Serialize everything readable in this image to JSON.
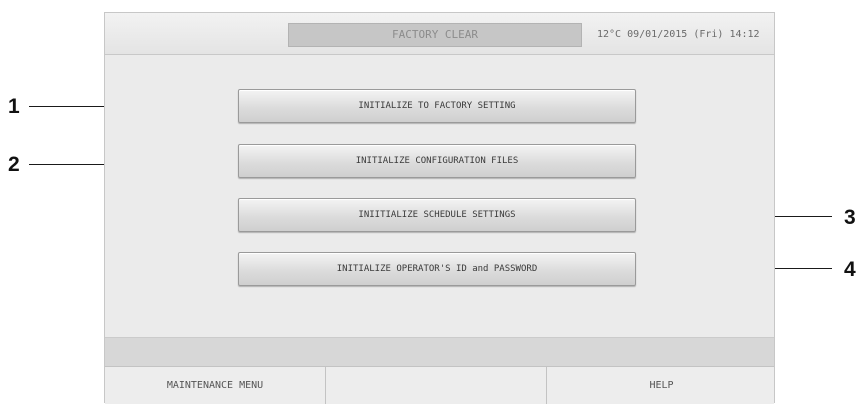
{
  "header": {
    "title": "FACTORY CLEAR",
    "status": "12°C  09/01/2015 (Fri) 14:12"
  },
  "buttons": [
    {
      "label": "INITIALIZE TO FACTORY SETTING"
    },
    {
      "label": "INITIALIZE CONFIGURATION FILES"
    },
    {
      "label": "INIITIALIZE SCHEDULE SETTINGS"
    },
    {
      "label": "INITIALIZE OPERATOR'S ID and PASSWORD"
    }
  ],
  "footer": {
    "maintenance_menu": "MAINTENANCE MENU",
    "middle": "",
    "help": "HELP"
  },
  "callouts": [
    "1",
    "2",
    "3",
    "4"
  ]
}
